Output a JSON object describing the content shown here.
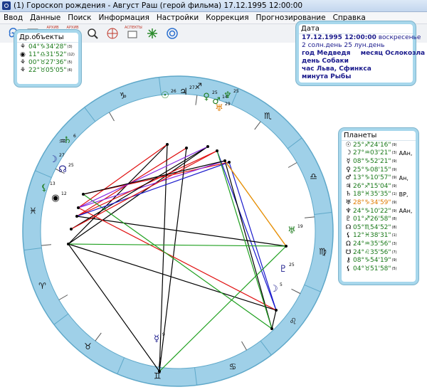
{
  "window": {
    "title": "(1) Гороскоп рождения - Август Раш (герой фильма) 17.12.1995  12:00:00"
  },
  "menu": [
    "Ввод",
    "Данные",
    "Поиск",
    "Информация",
    "Настройки",
    "Коррекция",
    "Прогнозирование",
    "Справка"
  ],
  "toolbar": [
    {
      "icon": "spiral-icon",
      "caption": ""
    },
    {
      "icon": "grid-icon",
      "caption": ""
    },
    {
      "icon": "archive-icon",
      "caption": "АРХИВ"
    },
    {
      "icon": "archive-edit-icon",
      "caption": "АРХИВ"
    },
    {
      "icon": "magnifier-icon",
      "caption": ""
    },
    {
      "icon": "sectors-icon",
      "caption": ""
    },
    {
      "icon": "aspects-icon",
      "caption": "АСПЕКТЫ"
    },
    {
      "icon": "asterisk-icon",
      "caption": ""
    },
    {
      "icon": "target-icon",
      "caption": ""
    }
  ],
  "other_objects": {
    "title": "Др.объекты",
    "rows": [
      {
        "symbol": "⚘",
        "pos": "04°♑34'28\"",
        "mark": "(3)"
      },
      {
        "symbol": "◉",
        "pos": "11°♎31'52\"",
        "mark": "(12)"
      },
      {
        "symbol": "⚘",
        "pos": "00°♉27'36\"",
        "mark": "(5)"
      },
      {
        "symbol": "⚘",
        "pos": "22°♉05'05\"",
        "mark": "(6)"
      }
    ]
  },
  "date_panel": {
    "title": "Дата",
    "line1_date": "17.12.1995  12:00:00",
    "line1_day": "воскресенье",
    "line2": "2 солн.день 25 лун.день",
    "line3a": "год Медведя",
    "line3b": "месяц Ослокозла",
    "line4": "день Собаки",
    "line5": "час Льва, Сфинкса",
    "line6": "минута Рыбы"
  },
  "planets": {
    "title": "Планеты",
    "rows": [
      {
        "symbol": "☉",
        "pos": "25°♐24'16\"",
        "mark": "(9)",
        "extra": "",
        "orange": false
      },
      {
        "symbol": "☽",
        "pos": "27°♒03'21\"",
        "mark": "(3)",
        "extra": "ААн,",
        "orange": false
      },
      {
        "symbol": "☿",
        "pos": "08°♑52'21\"",
        "mark": "(9)",
        "extra": "",
        "orange": false
      },
      {
        "symbol": "♀",
        "pos": "25°♑08'15\"",
        "mark": "(9)",
        "extra": "",
        "orange": false
      },
      {
        "symbol": "♂",
        "pos": "13°♑10'57\"",
        "mark": "(9)",
        "extra": "Ан,",
        "orange": false
      },
      {
        "symbol": "♃",
        "pos": "26°♐15'04\"",
        "mark": "(9)",
        "extra": "",
        "orange": false
      },
      {
        "symbol": "♄",
        "pos": "18°♓35'35\"",
        "mark": "(1)",
        "extra": "ВР,",
        "orange": false
      },
      {
        "symbol": "♅",
        "pos": "28°♑34'59\"",
        "mark": "(9)",
        "extra": "",
        "orange": true
      },
      {
        "symbol": "♆",
        "pos": "24°♑10'22\"",
        "mark": "(9)",
        "extra": "ААн,",
        "orange": false
      },
      {
        "symbol": "♇",
        "pos": "01°♐26'58\"",
        "mark": "(8)",
        "extra": "",
        "orange": false
      },
      {
        "symbol": "☊",
        "pos": "05°♏54'52\"",
        "mark": "(8)",
        "extra": "",
        "orange": false
      },
      {
        "symbol": "⚸",
        "pos": "12°♓38'31\"",
        "mark": "(1)",
        "extra": "",
        "orange": false
      },
      {
        "symbol": "Ω",
        "pos": "24°♒35'56\"",
        "mark": "(3)",
        "extra": "",
        "orange": false
      },
      {
        "symbol": "☋",
        "pos": "24°♌35'56\"",
        "mark": "(7)",
        "extra": "",
        "orange": false
      },
      {
        "symbol": "⚷",
        "pos": "08°♑54'19\"",
        "mark": "(9)",
        "extra": "",
        "orange": false
      },
      {
        "symbol": "⚸",
        "pos": "04°♉51'58\"",
        "mark": "(5)",
        "extra": "",
        "orange": false
      }
    ]
  },
  "chart": {
    "signs": [
      "♈",
      "♉",
      "♊",
      "♋",
      "♌",
      "♍",
      "♎",
      "♏",
      "♐",
      "♑",
      "♒",
      "♓"
    ],
    "cusp_labels": [
      "1",
      "2",
      "3",
      "4",
      "5",
      "6",
      "7",
      "8",
      "9",
      "10",
      "11",
      "12"
    ],
    "planet_labels": [
      {
        "glyph": "☉",
        "num": "26",
        "color": "#1a7a1a"
      },
      {
        "glyph": "♃",
        "num": "27",
        "color": "#000"
      },
      {
        "glyph": "♀",
        "num": "25",
        "color": "#1a7a1a"
      },
      {
        "glyph": "♂",
        "num": "14",
        "color": "#1a7a1a"
      },
      {
        "glyph": "♆",
        "num": "25",
        "color": "#1a7a1a"
      },
      {
        "glyph": "♅",
        "num": "29",
        "color": "#e07b00"
      },
      {
        "glyph": "♄",
        "num": "6",
        "color": "#1a7a1a"
      },
      {
        "glyph": "☽",
        "num": "27",
        "color": "#1a1a8c"
      },
      {
        "glyph": "☊",
        "num": "25",
        "color": "#1a1a8c"
      },
      {
        "glyph": "⚸",
        "num": "13",
        "color": "#1a7a1a"
      },
      {
        "glyph": "◉",
        "num": "12",
        "color": "#000"
      },
      {
        "glyph": "♇",
        "num": "25",
        "color": "#1a1a8c"
      },
      {
        "glyph": "☽",
        "num": "5",
        "color": "#1a1a8c"
      },
      {
        "glyph": "☿",
        "num": "9",
        "color": "#1a1a8c"
      },
      {
        "glyph": "♅",
        "num": "19",
        "color": "#1a7a1a"
      }
    ],
    "colors": {
      "ring": "#9fd0e8",
      "ring_border": "#5fa8c9",
      "red": "#e01010",
      "green": "#1fa01f",
      "blue": "#1a1acc",
      "black": "#000000",
      "purple": "#8a2be2",
      "orange": "#ff8c00"
    }
  }
}
